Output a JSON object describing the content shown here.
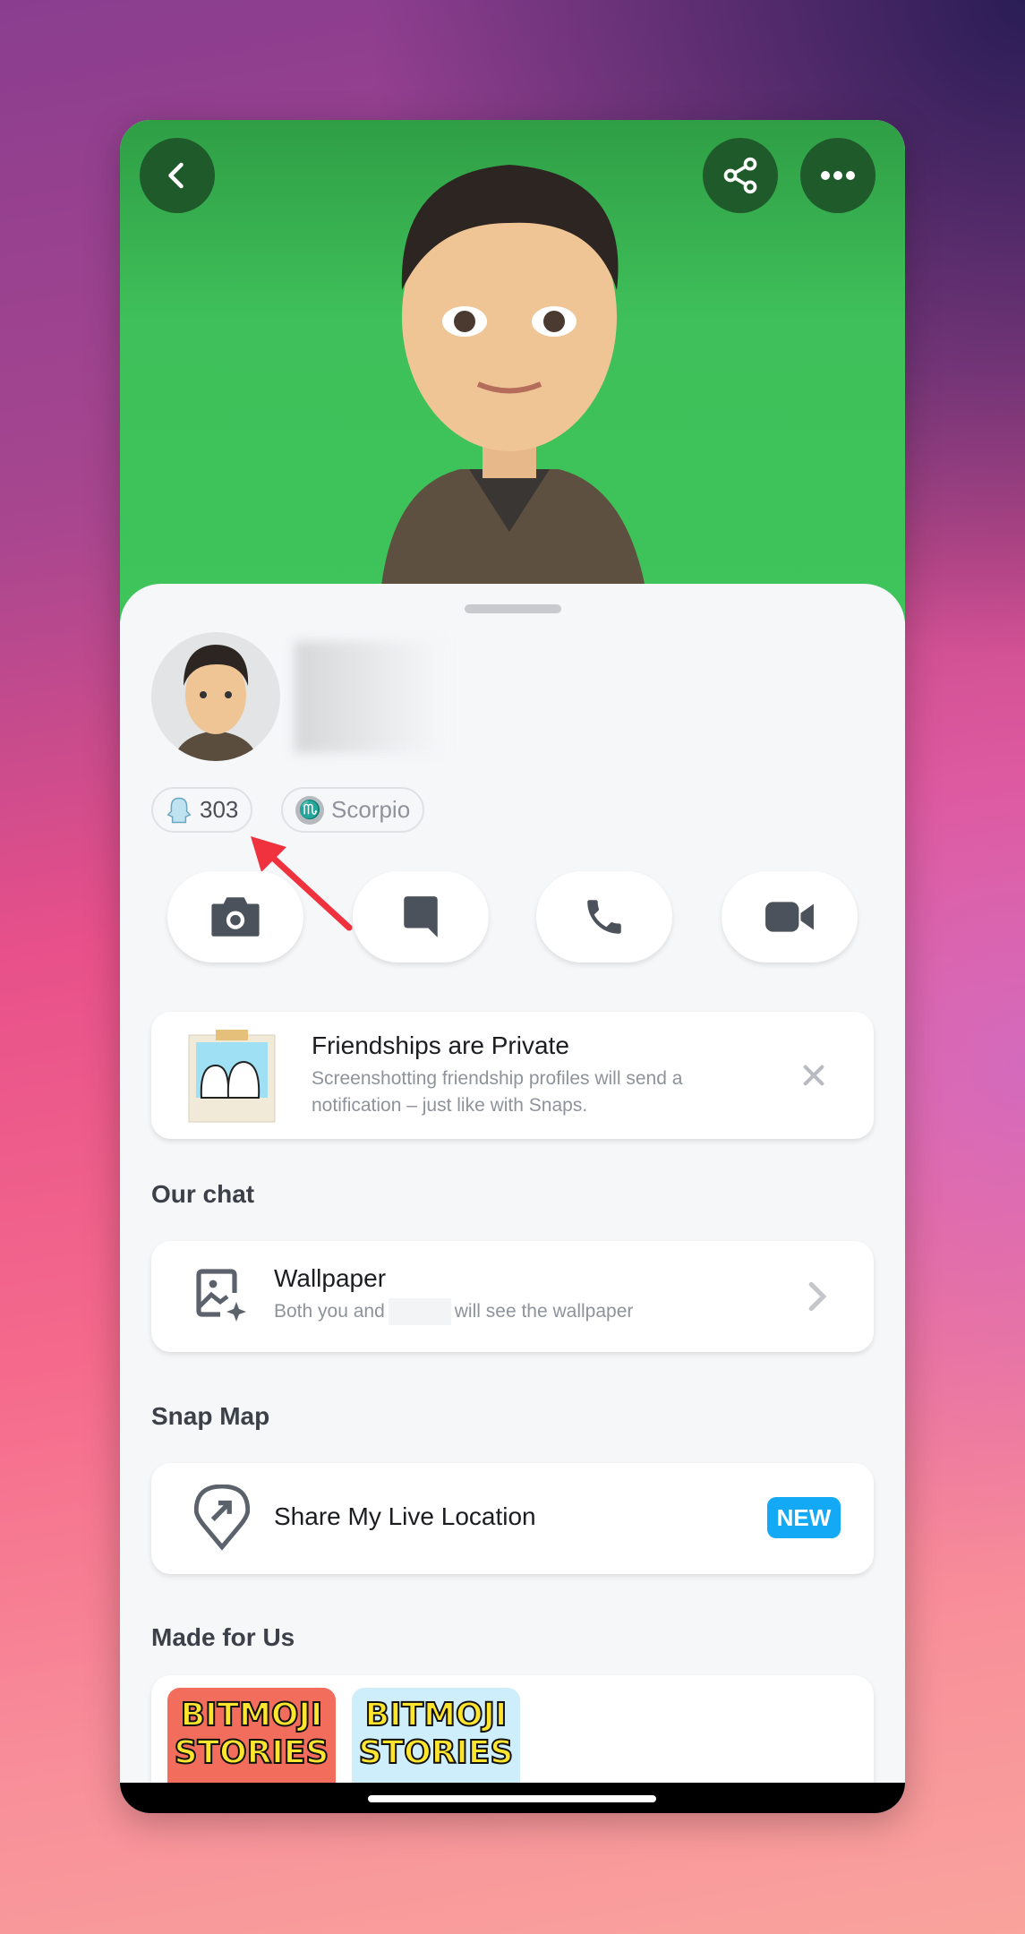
{
  "header": {
    "back": "chevron-left-icon",
    "share": "share-icon",
    "more": "more-horizontal-icon"
  },
  "profile": {
    "snapscore": "303",
    "zodiac": "Scorpio",
    "zodiac_glyph": "♏"
  },
  "actions": [
    "camera",
    "chat",
    "call",
    "video"
  ],
  "notice": {
    "title": "Friendships are Private",
    "body_line1": "Screenshotting friendship profiles will send a",
    "body_line2": "notification – just like with Snaps."
  },
  "our_chat": {
    "heading": "Our chat",
    "wallpaper_title": "Wallpaper",
    "wallpaper_sub_before": "Both you and",
    "wallpaper_sub_after": "will see the wallpaper"
  },
  "snap_map": {
    "heading": "Snap Map",
    "item": "Share My Live Location",
    "badge": "NEW",
    "badge_color": "#14a9f5"
  },
  "made_for_us": {
    "heading": "Made for Us",
    "tiles": [
      {
        "line1": "BITMOJI",
        "line2": "STORIES",
        "bg": "#f26d5b"
      },
      {
        "line1": "BITMOJI",
        "line2": "STORIES",
        "bg": "#cfeefc"
      }
    ]
  },
  "colors": {
    "hero_green": "#3ec45a",
    "annotation_arrow": "#f0323f"
  }
}
